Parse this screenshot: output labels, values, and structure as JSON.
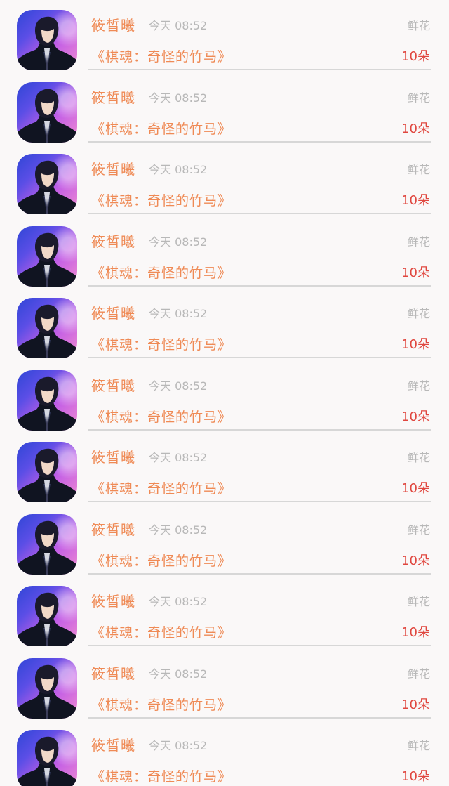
{
  "rows": [
    {
      "name": "筱晳曦",
      "time": "今天 08:52",
      "gift_type": "鲜花",
      "book": "《棋魂：奇怪的竹马》",
      "count": "10朵",
      "avatar_icon": "person-avatar-icon"
    },
    {
      "name": "筱晳曦",
      "time": "今天 08:52",
      "gift_type": "鲜花",
      "book": "《棋魂：奇怪的竹马》",
      "count": "10朵",
      "avatar_icon": "person-avatar-icon"
    },
    {
      "name": "筱晳曦",
      "time": "今天 08:52",
      "gift_type": "鲜花",
      "book": "《棋魂：奇怪的竹马》",
      "count": "10朵",
      "avatar_icon": "person-avatar-icon"
    },
    {
      "name": "筱晳曦",
      "time": "今天 08:52",
      "gift_type": "鲜花",
      "book": "《棋魂：奇怪的竹马》",
      "count": "10朵",
      "avatar_icon": "person-avatar-icon"
    },
    {
      "name": "筱晳曦",
      "time": "今天 08:52",
      "gift_type": "鲜花",
      "book": "《棋魂：奇怪的竹马》",
      "count": "10朵",
      "avatar_icon": "person-avatar-icon"
    },
    {
      "name": "筱晳曦",
      "time": "今天 08:52",
      "gift_type": "鲜花",
      "book": "《棋魂：奇怪的竹马》",
      "count": "10朵",
      "avatar_icon": "person-avatar-icon"
    },
    {
      "name": "筱晳曦",
      "time": "今天 08:52",
      "gift_type": "鲜花",
      "book": "《棋魂：奇怪的竹马》",
      "count": "10朵",
      "avatar_icon": "person-avatar-icon"
    },
    {
      "name": "筱晳曦",
      "time": "今天 08:52",
      "gift_type": "鲜花",
      "book": "《棋魂：奇怪的竹马》",
      "count": "10朵",
      "avatar_icon": "person-avatar-icon"
    },
    {
      "name": "筱晳曦",
      "time": "今天 08:52",
      "gift_type": "鲜花",
      "book": "《棋魂：奇怪的竹马》",
      "count": "10朵",
      "avatar_icon": "person-avatar-icon"
    },
    {
      "name": "筱晳曦",
      "time": "今天 08:52",
      "gift_type": "鲜花",
      "book": "《棋魂：奇怪的竹马》",
      "count": "10朵",
      "avatar_icon": "person-avatar-icon"
    },
    {
      "name": "筱晳曦",
      "time": "今天 08:52",
      "gift_type": "鲜花",
      "book": "《棋魂：奇怪的竹马》",
      "count": "10朵",
      "avatar_icon": "person-avatar-icon"
    }
  ],
  "colors": {
    "name": "#ef8a55",
    "book": "#ef8a55",
    "meta": "#b8b8b8",
    "count": "#e0473f",
    "divider": "#d7d7d7"
  }
}
